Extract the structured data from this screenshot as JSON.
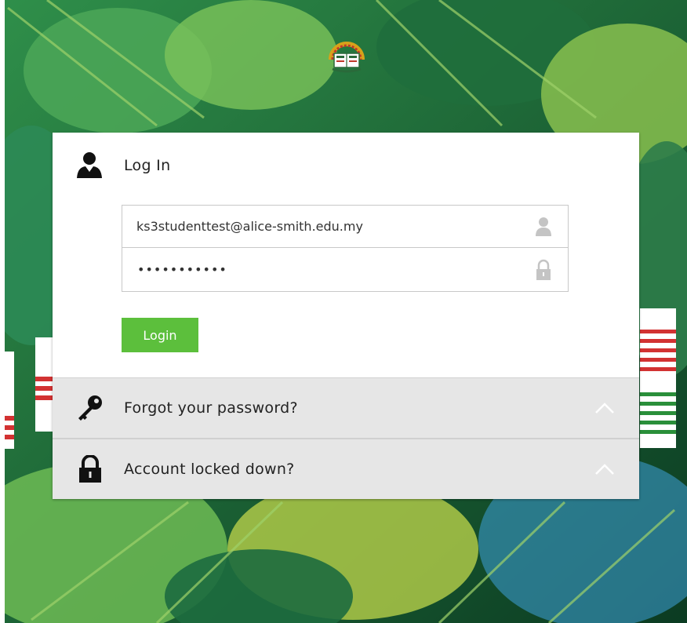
{
  "login": {
    "title": "Log In",
    "username_value": "ks3studenttest@alice-smith.edu.my",
    "password_mask": "•••••••••••",
    "submit_label": "Login"
  },
  "accordion": [
    {
      "label": "Forgot your password?",
      "icon": "key-icon"
    },
    {
      "label": "Account locked down?",
      "icon": "padlock-icon"
    }
  ],
  "colors": {
    "accent_green": "#5cbf3c",
    "panel_gray": "#e6e6e6"
  }
}
